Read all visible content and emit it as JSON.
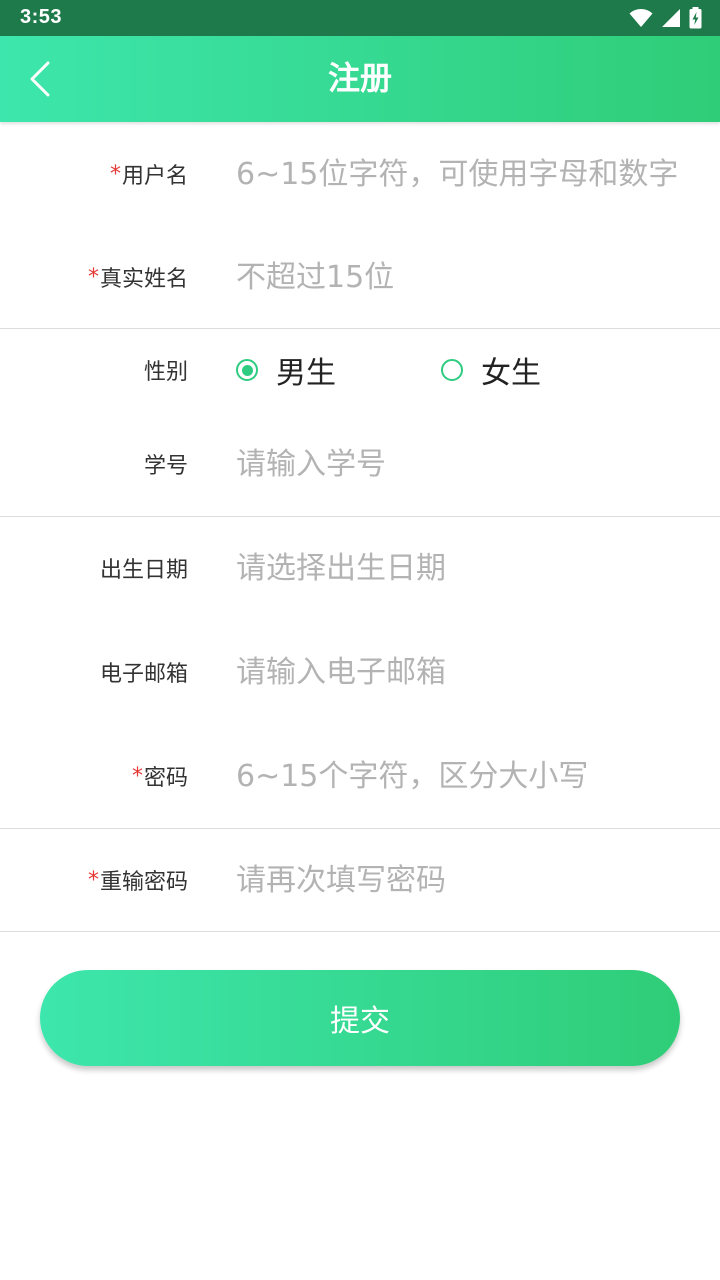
{
  "status_bar": {
    "time": "3:53",
    "icons": [
      "wifi-icon",
      "cellular-signal-icon",
      "battery-charging-icon"
    ],
    "background": "#1f7a4b"
  },
  "app_bar": {
    "title": "注册",
    "back_icon": "chevron-left-icon",
    "gradient_start": "#3de6ac",
    "gradient_end": "#2fcd78"
  },
  "form": {
    "required_mark": "*",
    "username": {
      "label": "用户名",
      "placeholder": "6~15位字符，可使用字母和数字",
      "value": ""
    },
    "real_name": {
      "label": "真实姓名",
      "placeholder": "不超过15位",
      "value": ""
    },
    "gender": {
      "label": "性别",
      "options": [
        {
          "label": "男生",
          "selected": true
        },
        {
          "label": "女生",
          "selected": false
        }
      ]
    },
    "student_id": {
      "label": "学号",
      "placeholder": "请输入学号",
      "value": ""
    },
    "birth_date": {
      "label": "出生日期",
      "placeholder": "请选择出生日期",
      "value": ""
    },
    "email": {
      "label": "电子邮箱",
      "placeholder": "请输入电子邮箱",
      "value": ""
    },
    "password": {
      "label": "密码",
      "placeholder": "6~15个字符，区分大小写",
      "value": ""
    },
    "confirm_password": {
      "label": "重输密码",
      "placeholder": "请再次填写密码",
      "value": ""
    }
  },
  "submit": {
    "label": "提交"
  },
  "colors": {
    "accent": "#2ecc80",
    "required": "#e53935",
    "placeholder": "#b3b3b3",
    "divider": "#dddddd"
  }
}
